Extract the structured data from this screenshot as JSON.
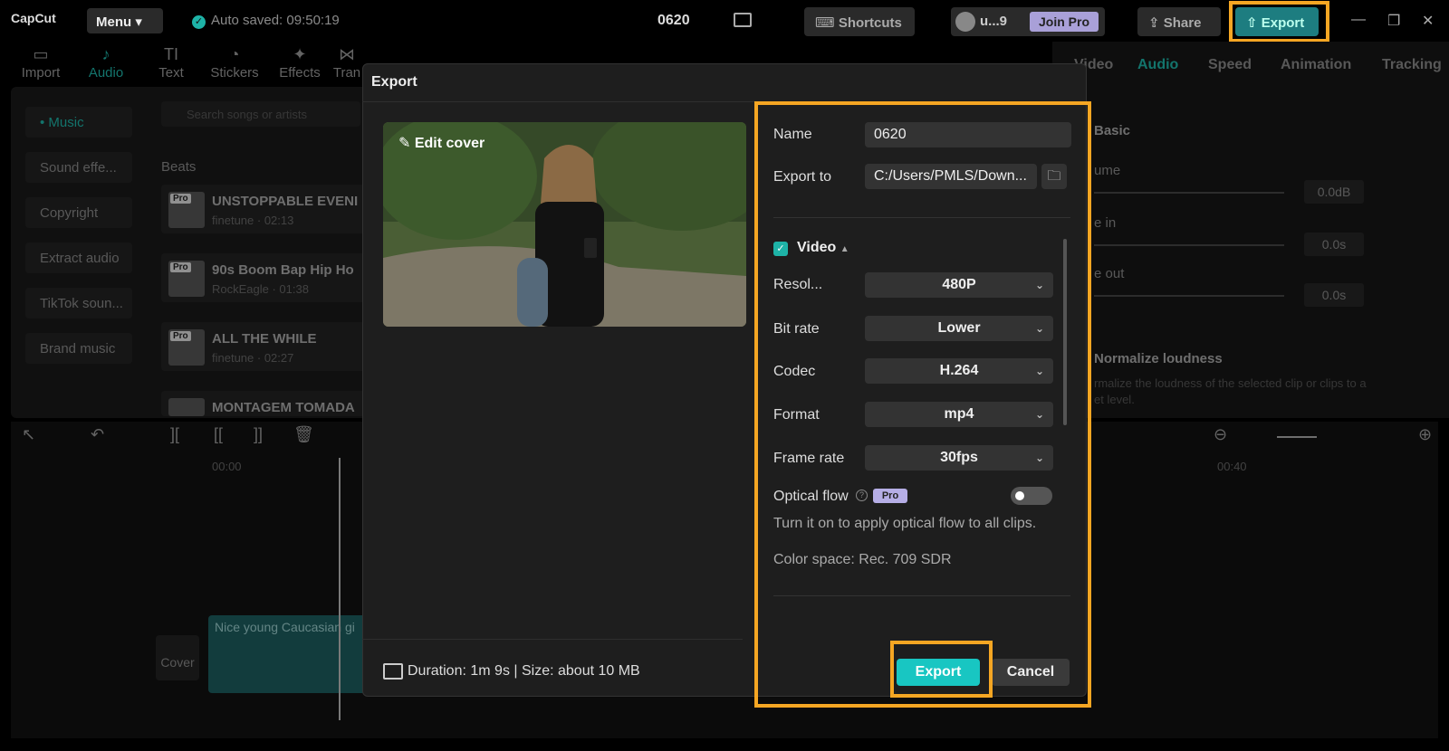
{
  "app": {
    "logo": "CapCut",
    "menu_label": "Menu",
    "autosave": "Auto saved: 09:50:19",
    "project_title": "0620",
    "shortcuts_label": "Shortcuts",
    "username": "u...9",
    "join_pro_label": "Join Pro",
    "share_label": "Share",
    "export_label": "Export",
    "accent_color": "#1eb3a7",
    "highlight_color": "#f5a623"
  },
  "toolbar": {
    "items": [
      {
        "label": "Import",
        "icon": "import-icon"
      },
      {
        "label": "Audio",
        "icon": "audio-icon",
        "active": true
      },
      {
        "label": "Text",
        "icon": "text-icon"
      },
      {
        "label": "Stickers",
        "icon": "stickers-icon"
      },
      {
        "label": "Effects",
        "icon": "effects-icon"
      },
      {
        "label": "Tran",
        "icon": "transitions-icon"
      }
    ]
  },
  "audio_panel": {
    "categories": [
      "Music",
      "Sound effe...",
      "Copyright",
      "Extract audio",
      "TikTok soun...",
      "Brand music"
    ],
    "search_placeholder": "Search songs or artists",
    "section_label": "Beats",
    "tracks": [
      {
        "title": "UNSTOPPABLE EVENI",
        "sub": "finetune · 02:13",
        "badge": "Pro"
      },
      {
        "title": "90s Boom Bap Hip Ho",
        "sub": "RockEagle · 01:38",
        "badge": "Pro"
      },
      {
        "title": "ALL THE WHILE",
        "sub": "finetune · 02:27",
        "badge": "Pro"
      },
      {
        "title": "MONTAGEM TOMADA",
        "sub": "",
        "badge": ""
      }
    ]
  },
  "right_panel": {
    "tabs": [
      "Video",
      "Audio",
      "Speed",
      "Animation",
      "Tracking"
    ],
    "section": "Basic",
    "rows": [
      {
        "label": "ume",
        "value": "0.0dB"
      },
      {
        "label": "e in",
        "value": "0.0s"
      },
      {
        "label": "e out",
        "value": "0.0s"
      }
    ],
    "normalize_label": "Normalize loudness",
    "normalize_desc_1": "rmalize the loudness of the selected clip or clips to a",
    "normalize_desc_2": "et level."
  },
  "timeline": {
    "ruler": [
      "00:00",
      "00:40"
    ],
    "clip_label": "Nice young Caucasian gi",
    "cover_label": "Cover"
  },
  "dialog": {
    "title": "Export",
    "edit_cover_label": "Edit cover",
    "name_label": "Name",
    "name_value": "0620",
    "export_to_label": "Export to",
    "export_to_value": "C:/Users/PMLS/Down...",
    "video_label": "Video",
    "video_checked": true,
    "resolution_label": "Resol...",
    "resolution_value": "480P",
    "bitrate_label": "Bit rate",
    "bitrate_value": "Lower",
    "codec_label": "Codec",
    "codec_value": "H.264",
    "format_label": "Format",
    "format_value": "mp4",
    "framerate_label": "Frame rate",
    "framerate_value": "30fps",
    "optical_flow_label": "Optical flow",
    "pro_badge": "Pro",
    "optical_flow_on": false,
    "optical_flow_help": "Turn it on to apply optical flow to all clips.",
    "color_space": "Color space: Rec. 709 SDR",
    "duration_info": "Duration: 1m 9s | Size: about 10 MB",
    "export_button": "Export",
    "cancel_button": "Cancel"
  }
}
